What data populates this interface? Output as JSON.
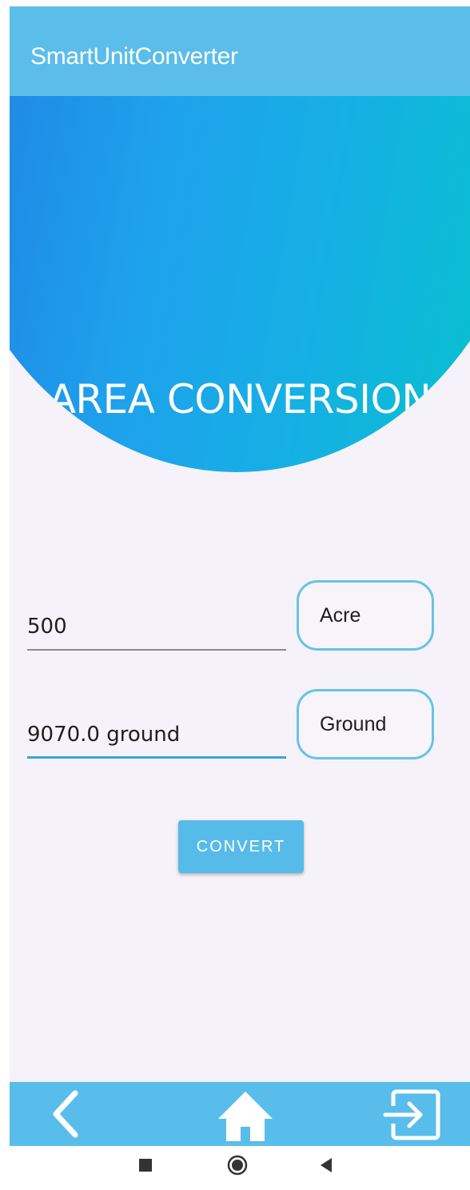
{
  "app_bar": {
    "title": "SmartUnitConverter"
  },
  "hero": {
    "title": "AREA CONVERSION"
  },
  "converter": {
    "input_value": "500",
    "input_unit": "Acre",
    "output_value": "9070.0 ground",
    "output_unit": "Ground",
    "convert_label": "CONVERT"
  },
  "bottom_nav": {
    "items": [
      {
        "icon": "chevron-left-icon"
      },
      {
        "icon": "home-icon"
      },
      {
        "icon": "exit-icon"
      }
    ]
  },
  "system_nav": {
    "items": [
      {
        "icon": "recent-apps-icon"
      },
      {
        "icon": "home-circle-icon"
      },
      {
        "icon": "back-triangle-icon"
      }
    ]
  },
  "colors": {
    "primary": "#5bbde9",
    "underline_active": "#36a6da",
    "outline": "#66c3e5",
    "background": "#f6f2f9"
  }
}
